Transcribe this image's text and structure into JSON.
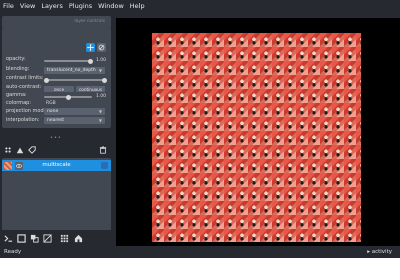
{
  "menu": [
    "File",
    "View",
    "Layers",
    "Plugins",
    "Window",
    "Help"
  ],
  "layer_controls": {
    "header_title": "layer controls",
    "rows": {
      "opacity": {
        "label": "opacity:",
        "value": "1.00"
      },
      "blending": {
        "label": "blending:",
        "value": "translucent_no_depth"
      },
      "contrast_limits": {
        "label": "contrast limits:"
      },
      "auto_contrast": {
        "label": "auto-contrast:",
        "once": "once",
        "continuous": "continuous"
      },
      "gamma": {
        "label": "gamma:",
        "value": "1.00"
      },
      "colormap": {
        "label": "colormap:",
        "value": "RGB"
      },
      "projection_mode": {
        "label": "projection mode:",
        "value": "none"
      },
      "interpolation": {
        "label": "interpolation:",
        "value": "nearest"
      }
    }
  },
  "layers": [
    {
      "name": "multiscale",
      "selected": true
    }
  ],
  "status": {
    "left": "Ready",
    "right": "activity"
  },
  "colors": {
    "accent": "#1f8fe0",
    "panel": "#414851",
    "background": "#262930"
  }
}
